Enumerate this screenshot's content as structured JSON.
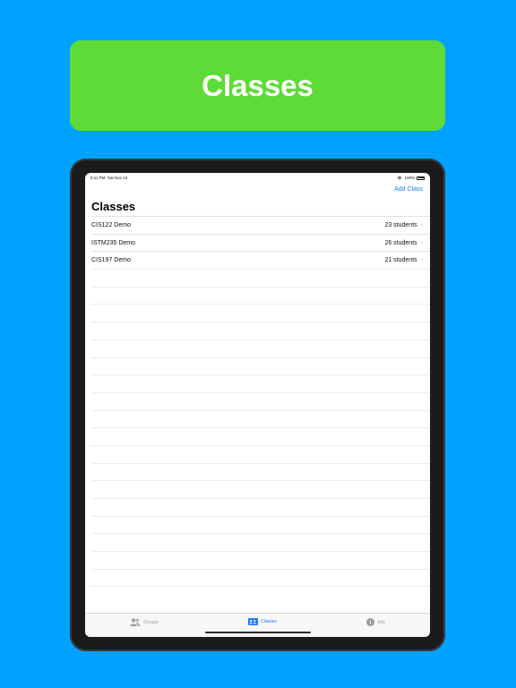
{
  "banner": {
    "title": "Classes"
  },
  "statusbar": {
    "time": "8:11 PM",
    "date": "Sat Nov 13",
    "battery": "100%"
  },
  "nav": {
    "add_label": "Add Class",
    "title": "Classes"
  },
  "classes": [
    {
      "name": "CIS122 Demo",
      "count": "23 students"
    },
    {
      "name": "ISTM235 Demo",
      "count": "26 students"
    },
    {
      "name": "CIS197 Demo",
      "count": "21 students"
    }
  ],
  "tabs": [
    {
      "label": "Groups",
      "icon": "groups-icon",
      "active": false
    },
    {
      "label": "Classes",
      "icon": "classes-icon",
      "active": true
    },
    {
      "label": "Info",
      "icon": "info-icon",
      "active": false
    }
  ],
  "colors": {
    "background": "#00A2FF",
    "banner": "#5EDB37",
    "accent": "#1F7CF5"
  }
}
